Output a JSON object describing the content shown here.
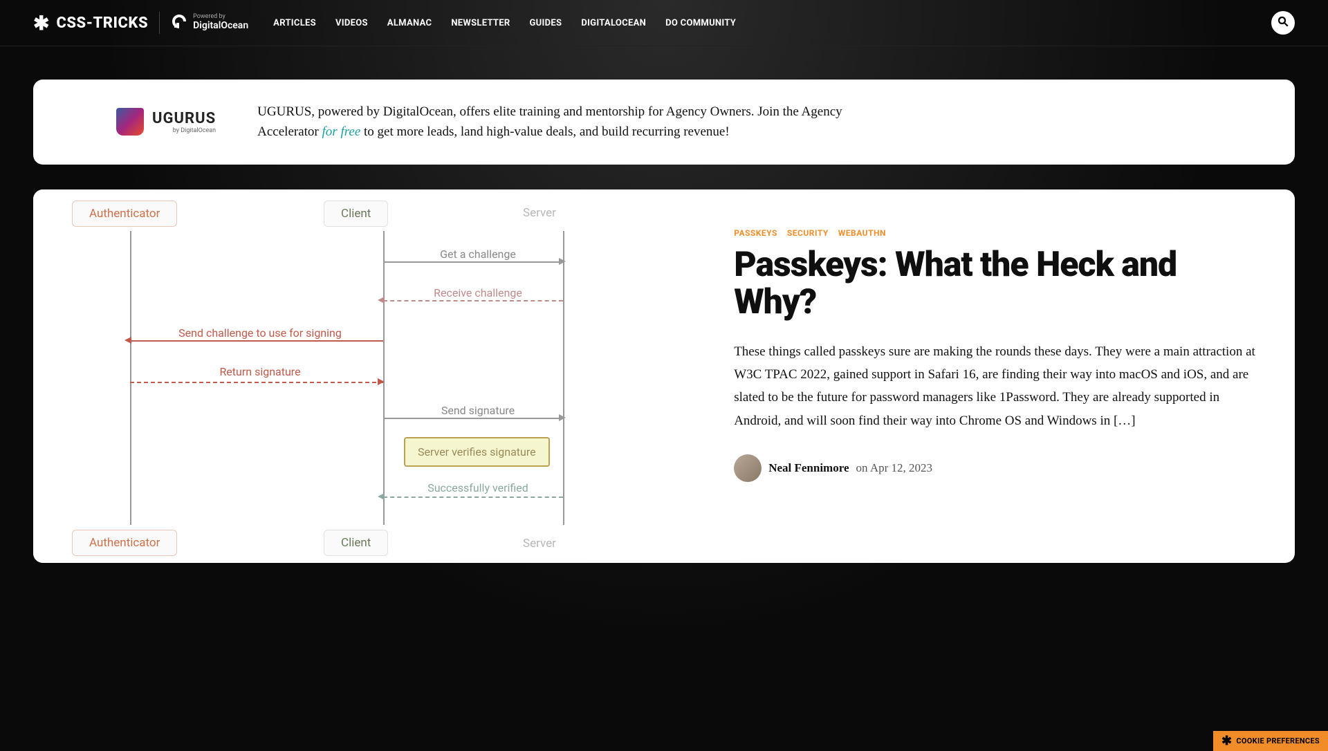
{
  "header": {
    "brand": "CSS-TRICKS",
    "powered_by_label": "Powered by",
    "powered_by_name": "DigitalOcean",
    "nav": [
      "ARTICLES",
      "VIDEOS",
      "ALMANAC",
      "NEWSLETTER",
      "GUIDES",
      "DIGITALOCEAN",
      "DO COMMUNITY"
    ]
  },
  "promo": {
    "logo_name": "UGURUS",
    "logo_by": "by DigitalOcean",
    "copy_before": "UGURUS, powered by DigitalOcean, offers elite training and mentorship for Agency Owners. Join the Agency Accelerator ",
    "for_free": "for free",
    "copy_after": " to get more leads, land high-value deals, and build recurring revenue!"
  },
  "article": {
    "tags": [
      "PASSKEYS",
      "SECURITY",
      "WEBAUTHN"
    ],
    "title": "Passkeys: What the Heck and Why?",
    "excerpt": "These things called passkeys sure are making the rounds these days. They were a main attraction at W3C TPAC 2022, gained support in Safari 16, are finding their way into macOS and iOS, and are slated to be the future for password managers like 1Password. They are already supported in Android, and will soon find their way into Chrome OS and Windows in […]",
    "author": "Neal Fennimore",
    "date_prefix": "on",
    "date": "Apr 12, 2023"
  },
  "diagram": {
    "lanes": {
      "auth": "Authenticator",
      "client": "Client",
      "server": "Server"
    },
    "messages": {
      "get_challenge": "Get a challenge",
      "receive_challenge": "Receive challenge",
      "send_challenge": "Send challenge to use for signing",
      "return_signature": "Return signature",
      "send_signature": "Send signature",
      "server_verifies": "Server verifies signature",
      "successfully_verified": "Successfully verified"
    }
  },
  "cookie_pref": "COOKIE PREFERENCES"
}
